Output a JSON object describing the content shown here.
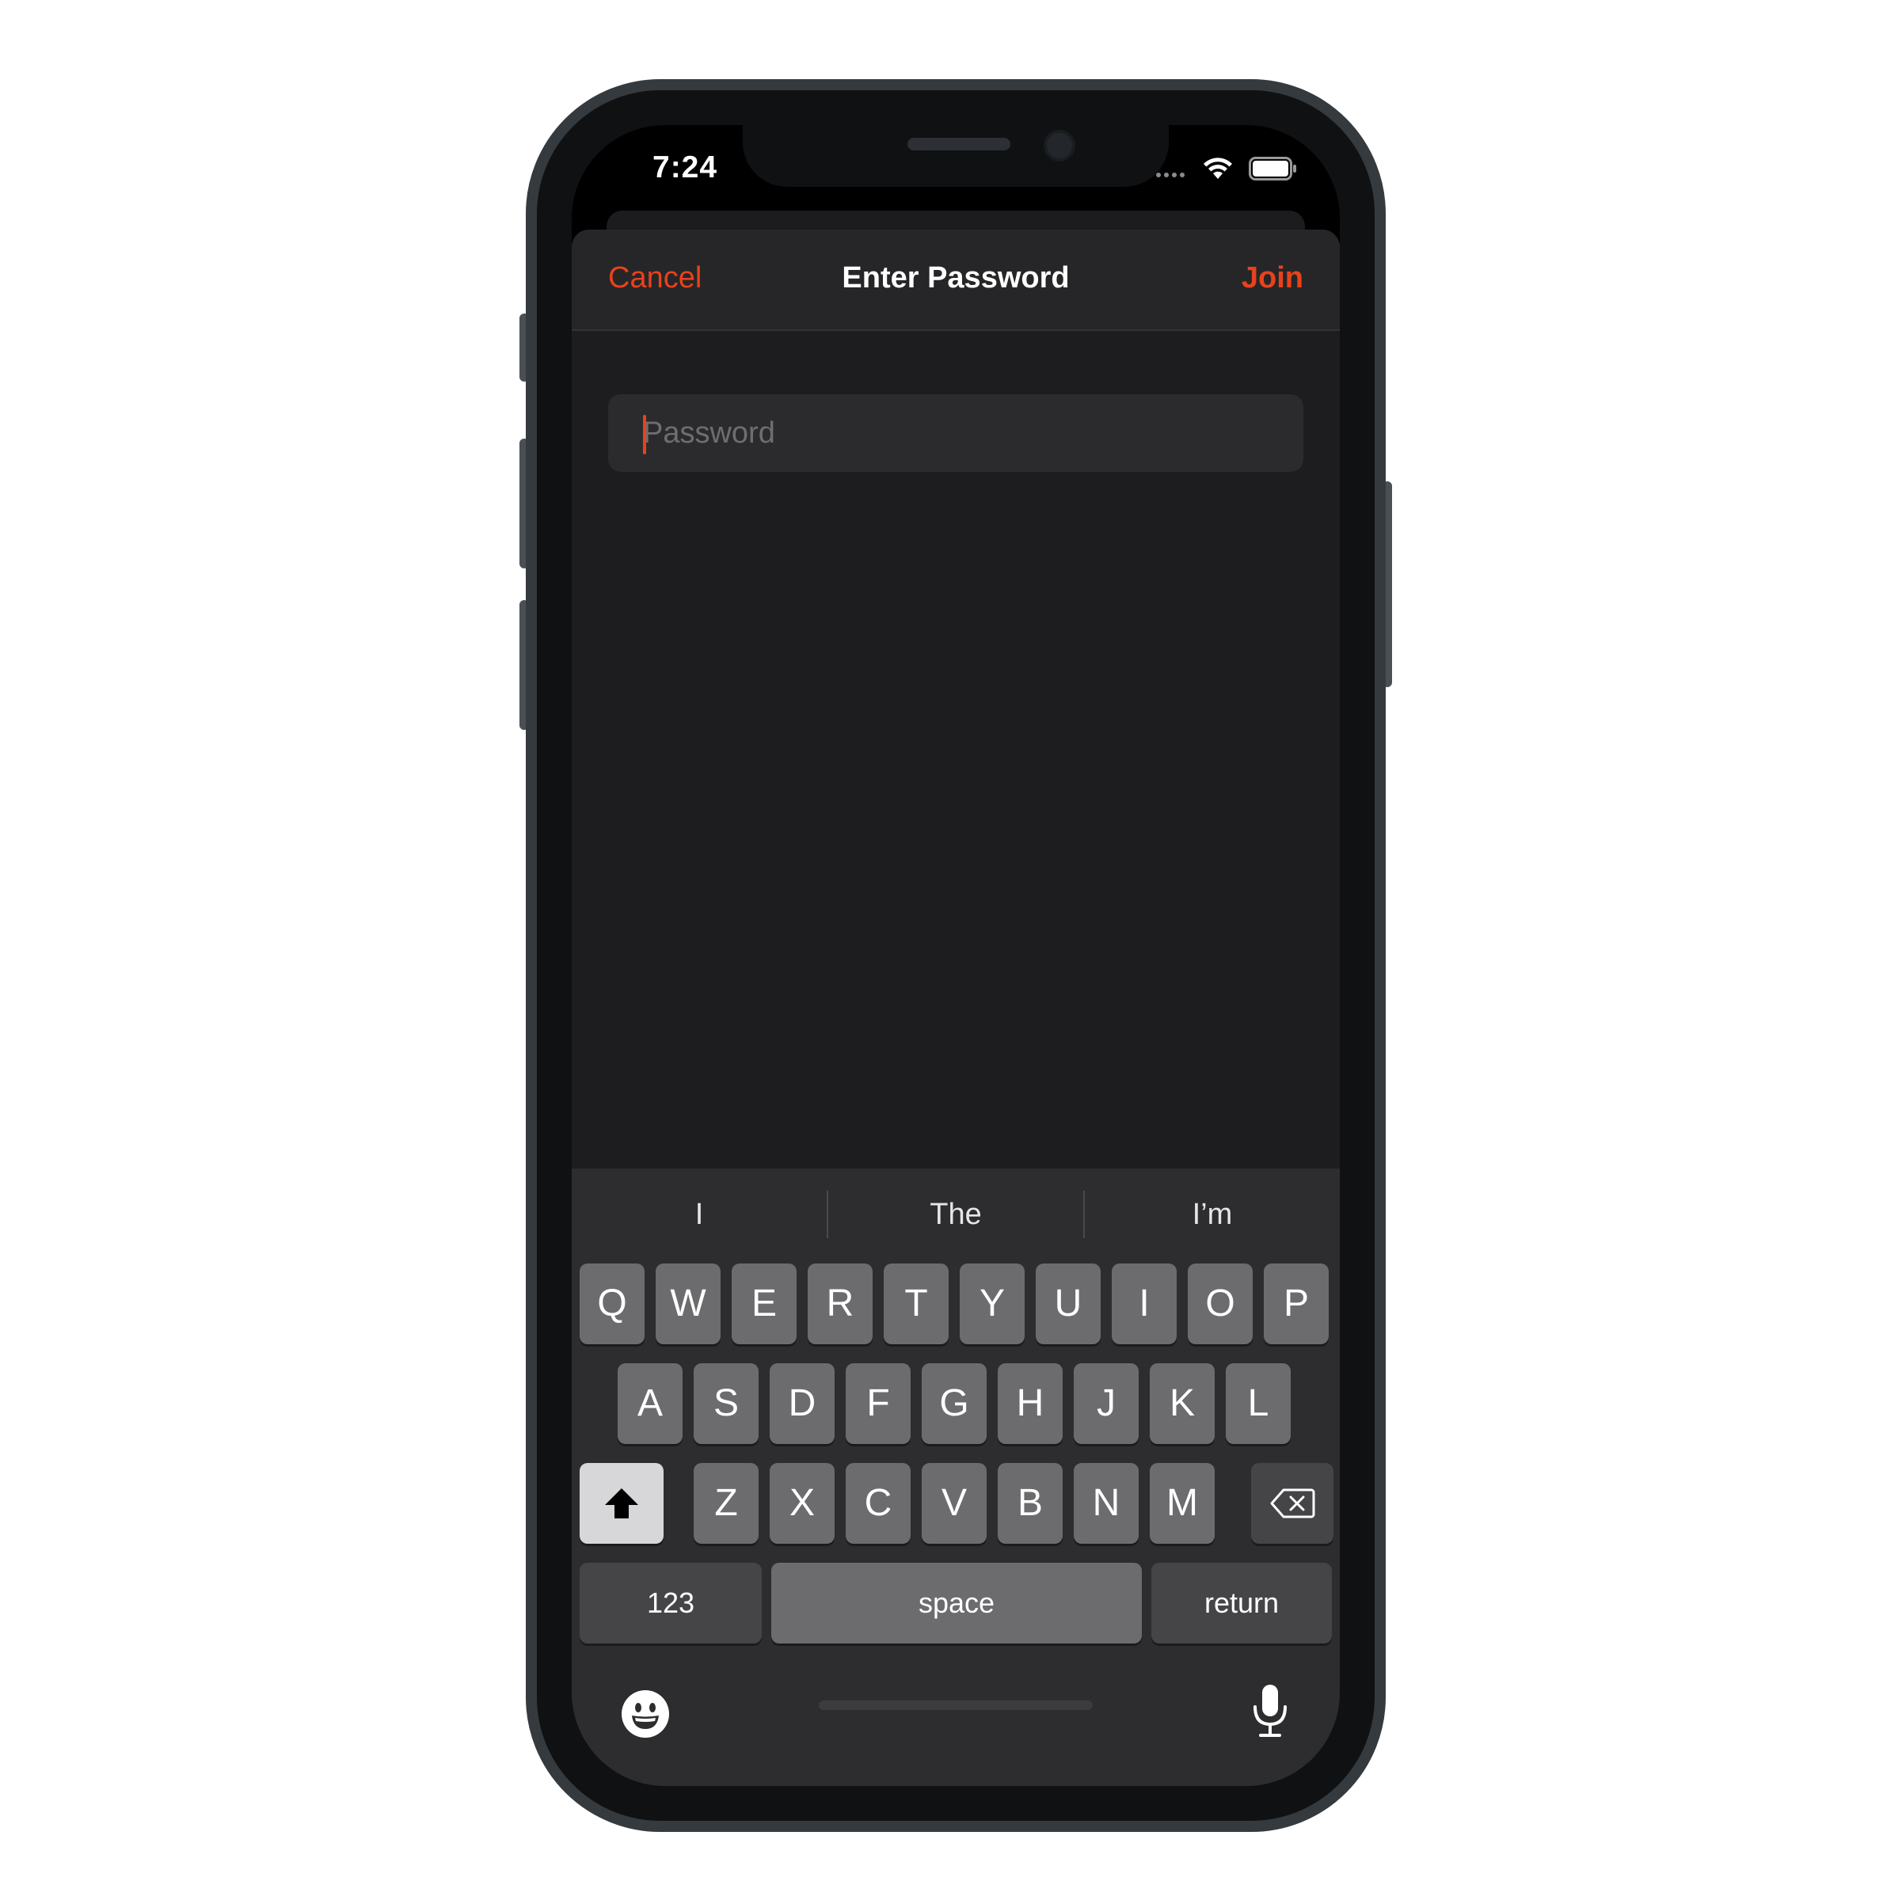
{
  "status_bar": {
    "time": "7:24",
    "wifi_icon": "wifi-icon",
    "battery_icon": "battery-icon"
  },
  "nav": {
    "cancel_label": "Cancel",
    "title": "Enter Password",
    "join_label": "Join"
  },
  "password_field": {
    "placeholder": "Password",
    "value": ""
  },
  "suggestions": [
    "I",
    "The",
    "I’m"
  ],
  "keyboard": {
    "row1": [
      "Q",
      "W",
      "E",
      "R",
      "T",
      "Y",
      "U",
      "I",
      "O",
      "P"
    ],
    "row2": [
      "A",
      "S",
      "D",
      "F",
      "G",
      "H",
      "J",
      "K",
      "L"
    ],
    "row3": [
      "Z",
      "X",
      "C",
      "V",
      "B",
      "N",
      "M"
    ],
    "numbers_label": "123",
    "space_label": "space",
    "return_label": "return",
    "shift_icon": "shift-icon",
    "delete_icon": "delete-icon",
    "emoji_icon": "emoji-icon",
    "mic_icon": "microphone-icon"
  },
  "colors": {
    "accent": "#e8421c",
    "sheet_background": "#1d1d1f",
    "keyboard_background": "#2d2d2f",
    "key": "#6c6c6e"
  }
}
